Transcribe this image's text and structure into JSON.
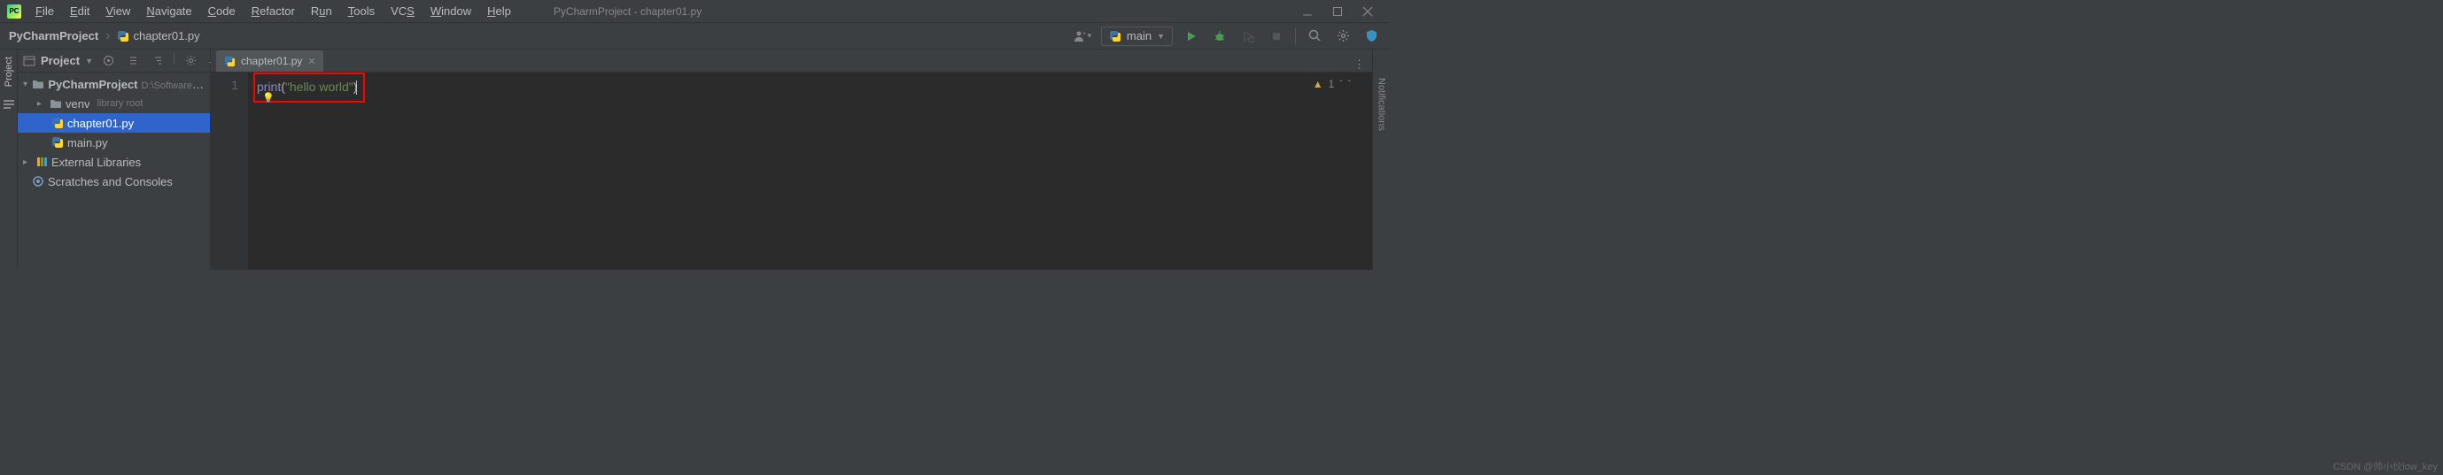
{
  "title": "PyCharmProject - chapter01.py",
  "menu": [
    "File",
    "Edit",
    "View",
    "Navigate",
    "Code",
    "Refactor",
    "Run",
    "Tools",
    "VCS",
    "Window",
    "Help"
  ],
  "breadcrumb": {
    "root": "PyCharmProject",
    "file": "chapter01.py"
  },
  "runconfig": {
    "label": "main"
  },
  "sidebar": {
    "title": "Project",
    "project": {
      "name": "PyCharmProject",
      "path": "D:\\Software\\PyCharm\\PyCharmPro"
    },
    "venv": {
      "name": "venv",
      "note": "library root"
    },
    "files": [
      "chapter01.py",
      "main.py"
    ],
    "external": "External Libraries",
    "scratches": "Scratches and Consoles"
  },
  "tab": {
    "label": "chapter01.py"
  },
  "editor": {
    "lineno": "1",
    "code_kw": "print",
    "code_par1": "(",
    "code_str": "\"hello world\"",
    "code_par2": ")"
  },
  "inspection": {
    "count": "1"
  },
  "rail": {
    "project": "Project",
    "notifications": "Notifications"
  },
  "watermark": "CSDN @帅小伙low_key"
}
